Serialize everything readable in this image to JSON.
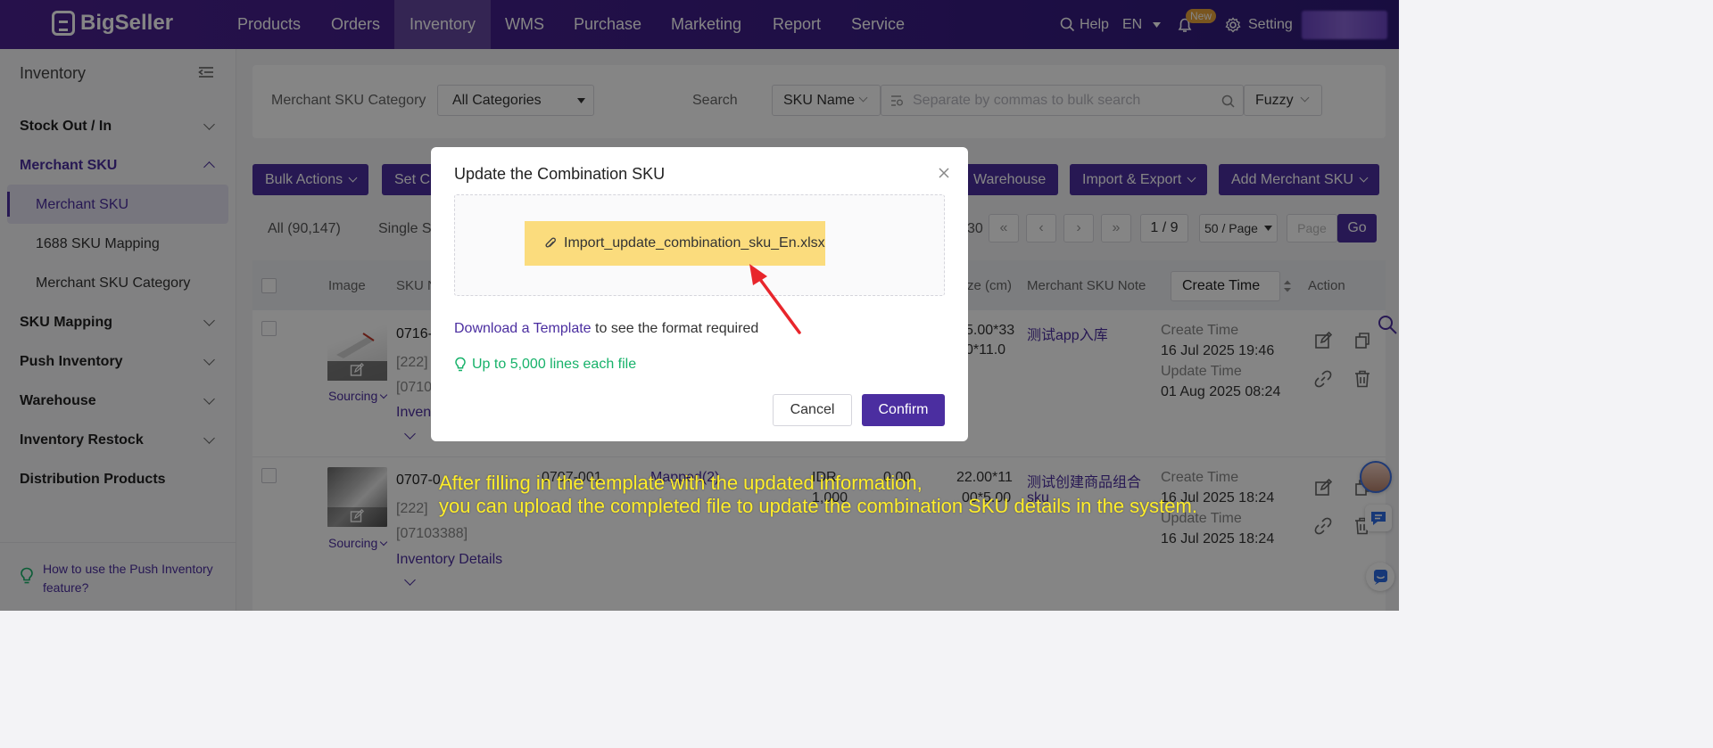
{
  "nav": {
    "brand": "BigSeller",
    "items": [
      "Products",
      "Orders",
      "Inventory",
      "WMS",
      "Purchase",
      "Marketing",
      "Report",
      "Service"
    ],
    "help": "Help",
    "lang": "EN",
    "new_badge": "New",
    "setting": "Setting"
  },
  "sidebar": {
    "title": "Inventory",
    "stock": "Stock Out / In",
    "merchant_sku": "Merchant SKU",
    "merchant_sku_sub": "Merchant SKU",
    "mapping_1688": "1688 SKU Mapping",
    "sku_category": "Merchant SKU Category",
    "sku_mapping": "SKU Mapping",
    "push_inventory": "Push Inventory",
    "warehouse": "Warehouse",
    "restock": "Inventory Restock",
    "distribution": "Distribution Products",
    "help_link": "How to use the Push Inventory feature?"
  },
  "filters": {
    "category_label": "Merchant SKU Category",
    "category_value": "All Categories",
    "search_label": "Search",
    "search_field": "SKU Name",
    "search_placeholder": "Separate by commas to bulk search",
    "match_mode": "Fuzzy"
  },
  "toolbar": {
    "bulk_actions": "Bulk Actions",
    "set_partial": "Set C",
    "warehouse_partial": "Warehouse",
    "import_export": "Import & Export",
    "add_sku": "Add Merchant SKU"
  },
  "tabs": {
    "all": "All (90,147)",
    "single_partial": "Single Sk",
    "count_tail": "30"
  },
  "pagination": {
    "page": "1 / 9",
    "page_size": "50 / Page",
    "page_placeholder": "Page",
    "go": "Go"
  },
  "table": {
    "headers": {
      "image": "Image",
      "sku_partial": "SKU N",
      "size_partial": "ze (cm)",
      "note": "Merchant SKU Note",
      "create_time": "Create Time",
      "action": "Action"
    },
    "rows": [
      {
        "sku": "0716-",
        "id1": "[222]",
        "id2": "[0710",
        "inv_partial": "Invent",
        "size1": "5.00*33",
        "size2": "0*11.0",
        "note": "测试app入库",
        "create_label": "Create Time",
        "create_val": "16 Jul 2025 19:46",
        "update_label": "Update Time",
        "update_val": "01 Aug 2025 08:24",
        "sourcing": "Sourcing"
      },
      {
        "sku": "0707-0",
        "id1": "[222]",
        "id2": "[07103388]",
        "inv": "Inventory Details",
        "col_sku2": "0707-001",
        "mapped": "Mapped(2)",
        "currency": "IDR",
        "price": "1,000",
        "weight": "0.00",
        "size1": "22.00*11",
        "size2": "00*5.00",
        "note": "测试创建商品组合",
        "note2": "sku",
        "create_label": "Create Time",
        "create_val": "16 Jul 2025 18:24",
        "update_label": "Update Time",
        "update_val": "16 Jul 2025 18:24",
        "sourcing": "Sourcing"
      }
    ]
  },
  "modal": {
    "title": "Update the Combination SKU",
    "file_name": "Import_update_combination_sku_En.xlsx",
    "download_link": "Download a Template",
    "download_rest": " to see the format required",
    "tip": "Up to 5,000 lines each file",
    "cancel": "Cancel",
    "confirm": "Confirm"
  },
  "subtitles": {
    "line1": "After filling in the template with the updated information,",
    "line2": "you can upload the completed file to update the combination SKU details in the system."
  },
  "colors": {
    "brand_purple": "#4b2ea0",
    "nav_bg": "#3c1d86",
    "file_highlight": "#fbdc7d",
    "tip_green": "#17b26a",
    "arrow_red": "#e8262c",
    "subtitle_yellow": "#ffee2a"
  }
}
